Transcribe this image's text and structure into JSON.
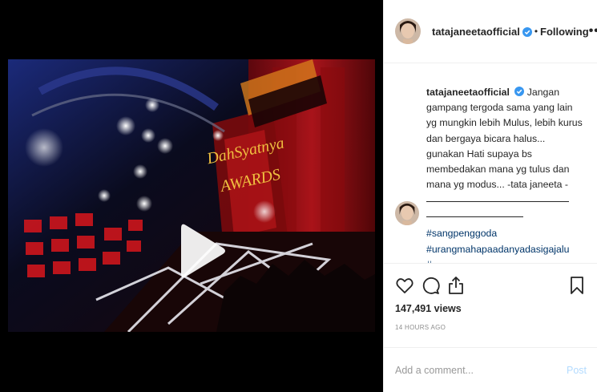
{
  "header": {
    "username": "tatajaneetaofficial",
    "separator": "•",
    "follow_status": "Following",
    "more_label": "•••"
  },
  "caption": {
    "username": "tatajaneetaofficial",
    "text": "Jangan gampang tergoda sama yang lain yg mungkin lebih Mulus, lebih kurus dan bergaya bicara halus... gunakan Hati supaya bs membedakan mana yg tulus dan mana yg modus... -tata janeeta -"
  },
  "hashtags": [
    "#sangpenggoda",
    "#urangmahapaadanyadasigajalu",
    "#..."
  ],
  "stats": {
    "views": "147,491 views",
    "time_ago": "14 HOURS AGO"
  },
  "comment_box": {
    "placeholder": "Add a comment...",
    "post_label": "Post"
  },
  "icons": {
    "verified": "verified-badge-icon",
    "like": "heart-icon",
    "comment": "comment-icon",
    "share": "share-icon",
    "save": "bookmark-icon",
    "play": "play-icon"
  },
  "colors": {
    "text": "#262626",
    "muted": "#8e8e8e",
    "link": "#003569",
    "verified": "#3897f0",
    "post_disabled": "#b3dbff"
  }
}
